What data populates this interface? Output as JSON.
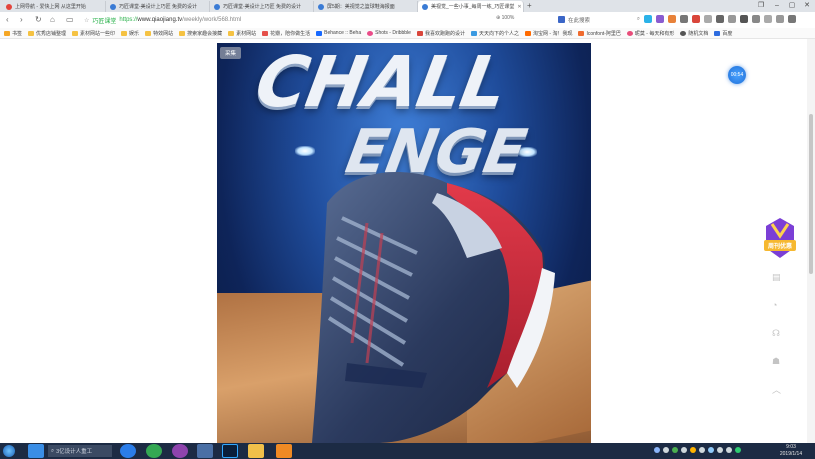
{
  "tabs": [
    {
      "title": "上网导航 - 爱快上网 从这里开始",
      "fav_color": "#e3443c",
      "active": false
    },
    {
      "title": "巧匠课堂-美设计上巧匠 免费的设计",
      "fav_color": "#3a7bd5",
      "active": false
    },
    {
      "title": "巧匠课堂-美设计上巧匠 免费的设计",
      "fav_color": "#3a7bd5",
      "active": false
    },
    {
      "title": "巧匠课堂-美设计上巧匠 免费的设计",
      "fav_color": "#3a7bd5",
      "active": false
    },
    {
      "title": "屏5期：美视觉之篮球鞋海报面",
      "fav_color": "#3a7bd5",
      "active": false
    },
    {
      "title": "美视觉_一些小事_每周一练_巧匠课堂",
      "fav_color": "#3a7bd5",
      "active": true
    }
  ],
  "window_controls": {
    "restore": "❐",
    "min": "–",
    "max": "▢",
    "close": "✕"
  },
  "nav": {
    "back": "‹",
    "forward": "›",
    "reload": "↻",
    "home": "⌂",
    "reader": "▭",
    "safe_label": "巧匠课堂",
    "url_proto": "https://",
    "url_host": "www.qiaojiang.tv",
    "url_path": "/weekly/work/568.html",
    "zoom": "100%",
    "search_placeholder": "在此搜索"
  },
  "bookmarks": [
    {
      "label": "书签",
      "color": "#f5a623"
    },
    {
      "label": "优秀店铺整理",
      "color": "#f5c242"
    },
    {
      "label": "素材网站一些印",
      "color": "#f5c242"
    },
    {
      "label": "娱乐",
      "color": "#f5c242"
    },
    {
      "label": "特效网站",
      "color": "#f5c242"
    },
    {
      "label": "搜索家趣会接藏",
      "color": "#f5c242"
    },
    {
      "label": "素材网站",
      "color": "#f5c242"
    },
    {
      "label": "花瓣，陪你做生活",
      "color": "#e5504a"
    },
    {
      "label": "Behance :: Beha",
      "color": "#1769ff"
    },
    {
      "label": "Shots - Dribbble",
      "color": "#ea4c89"
    },
    {
      "label": "我喜欢跑跑的设计",
      "color": "#d9463b"
    },
    {
      "label": "天天向下的个人之",
      "color": "#3b9ae1"
    },
    {
      "label": "淘宝网 - 淘！我现",
      "color": "#ff6a00"
    },
    {
      "label": "Iconfont-阿里巴",
      "color": "#f06b2e"
    },
    {
      "label": "昵莫 - 每天和有形",
      "color": "#e84d7a"
    },
    {
      "label": "随机文档",
      "color": "#555"
    },
    {
      "label": "百度",
      "color": "#2d6cdf"
    }
  ],
  "poster": {
    "badge": "采集",
    "headline_1": "CHALL",
    "headline_2": "ENGE"
  },
  "timer": "00:54",
  "promo_text": "周刊优惠",
  "side_icons": [
    "cart-icon",
    "chat-icon",
    "headset-icon",
    "share-icon",
    "up-arrow-icon"
  ],
  "taskbar": {
    "search_text": "3亿设计人重工",
    "time": "9:03",
    "date": "2019/1/14"
  }
}
